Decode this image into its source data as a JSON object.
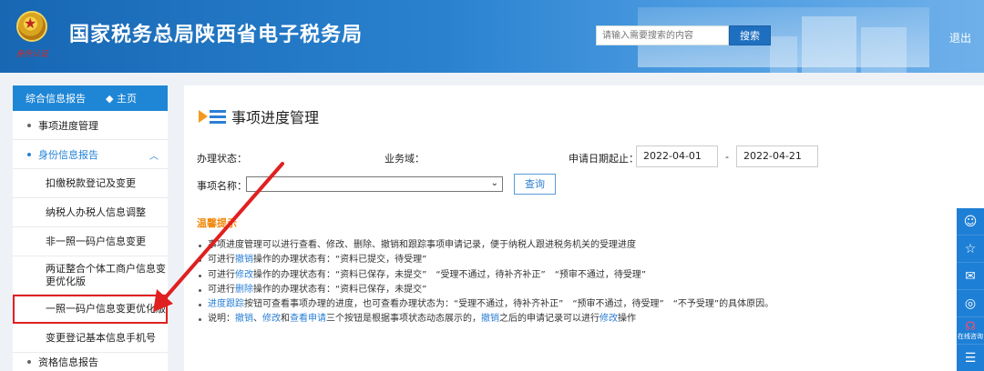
{
  "header": {
    "site_title": "国家税务总局陕西省电子税务局",
    "emblem_signature": "身份认证",
    "search_placeholder": "请输入需要搜索的内容",
    "search_button": "搜索",
    "logout": "退出"
  },
  "sidebar": {
    "head_label": "综合信息报告",
    "home_label": "主页",
    "items": [
      {
        "label": "事项进度管理"
      },
      {
        "label": "身份信息报告"
      }
    ],
    "sub_items": [
      {
        "label": "扣缴税款登记及变更"
      },
      {
        "label": "纳税人办税人信息调整"
      },
      {
        "label": "非一照一码户信息变更"
      },
      {
        "label": "两证整合个体工商户信息变更优化版"
      },
      {
        "label": "一照一码户信息变更优化版"
      },
      {
        "label": "变更登记基本信息手机号"
      }
    ],
    "cut_item": "资格信息报告"
  },
  "main": {
    "page_title": "事项进度管理",
    "status_label": "办理状态：",
    "domain_label": "业务域：",
    "date_label": "申请日期起止：",
    "date_start": "2022-04-01",
    "date_sep": "-",
    "date_end": "2022-04-21",
    "item_name_label": "事项名称：",
    "query_button": "查询",
    "tips_title": "温馨提示",
    "tips": [
      {
        "parts": [
          {
            "t": "事项进度管理可以进行查看、修改、删除、撤销和跟踪事项申请记录，便于纳税人跟进税务机关的受理进度",
            "c": ""
          }
        ]
      },
      {
        "parts": [
          {
            "t": "可进行",
            "c": ""
          },
          {
            "t": "撤销",
            "c": "blue"
          },
          {
            "t": "操作的办理状态有：“资料已提交，待受理”",
            "c": ""
          }
        ]
      },
      {
        "parts": [
          {
            "t": "可进行",
            "c": ""
          },
          {
            "t": "修改",
            "c": "blue"
          },
          {
            "t": "操作的办理状态有：“资料已保存，未提交”　“受理不通过，待补齐补正”　“预审不通过，待受理”",
            "c": ""
          }
        ]
      },
      {
        "parts": [
          {
            "t": "可进行",
            "c": ""
          },
          {
            "t": "删除",
            "c": "blue"
          },
          {
            "t": "操作的办理状态有：“资料已保存，未提交”",
            "c": ""
          }
        ]
      },
      {
        "parts": [
          {
            "t": "进度跟踪",
            "c": "blue"
          },
          {
            "t": "按钮可查看事项办理的进度，也可查看办理状态为：“受理不通过，待补齐补正”　“预审不通过，待受理”　“不予受理”的具体原因。",
            "c": ""
          }
        ]
      },
      {
        "parts": [
          {
            "t": "说明：",
            "c": ""
          },
          {
            "t": "撤销",
            "c": "blue"
          },
          {
            "t": "、",
            "c": ""
          },
          {
            "t": "修改",
            "c": "blue"
          },
          {
            "t": "和",
            "c": ""
          },
          {
            "t": "查看申请",
            "c": "blue"
          },
          {
            "t": "三个按钮是根据事项状态动态展示的，",
            "c": ""
          },
          {
            "t": "撤销",
            "c": "blue"
          },
          {
            "t": "之后的申请记录可以进行",
            "c": ""
          },
          {
            "t": "修改",
            "c": "blue"
          },
          {
            "t": "操作",
            "c": ""
          }
        ]
      }
    ]
  },
  "right_toolbar": {
    "buttons": [
      {
        "icon": "user-service-icon"
      },
      {
        "icon": "star-icon"
      },
      {
        "icon": "chat-icon"
      },
      {
        "icon": "weibo-icon"
      },
      {
        "icon": "online-consult-icon",
        "label": "在线咨询"
      },
      {
        "icon": "document-icon"
      }
    ]
  },
  "colors": {
    "header_blue": "#1767b3",
    "accent_blue": "#1f86d6",
    "tips_orange": "#f08a10",
    "arrow_red": "#e02020"
  }
}
